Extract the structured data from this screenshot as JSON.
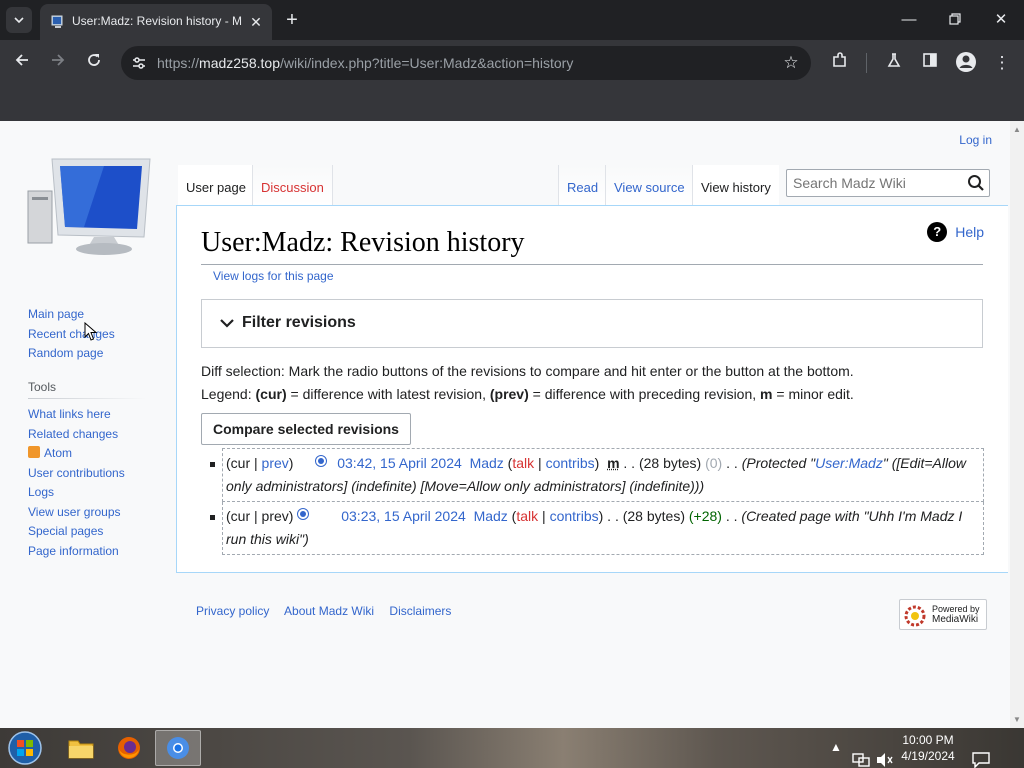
{
  "browser": {
    "tab_title": "User:Madz: Revision history - Madz Wiki",
    "url_scheme": "https://",
    "url_host": "madz258.top",
    "url_path": "/wiki/index.php?title=User:Madz&action=history"
  },
  "wiki": {
    "personal": {
      "login": "Log in"
    },
    "nav": {
      "main_page": "Main page",
      "recent_changes": "Recent changes",
      "random_page": "Random page"
    },
    "tools": {
      "heading": "Tools",
      "items": [
        "What links here",
        "Related changes",
        "Atom",
        "User contributions",
        "Logs",
        "View user groups",
        "Special pages",
        "Page information"
      ]
    },
    "tabs": {
      "user_page": "User page",
      "discussion": "Discussion",
      "read": "Read",
      "view_source": "View source",
      "view_history": "View history"
    },
    "search": {
      "placeholder": "Search Madz Wiki"
    },
    "help": "Help",
    "title": "User:Madz: Revision history",
    "view_logs": "View logs for this page",
    "filter": "Filter revisions",
    "diff_selection": "Diff selection: Mark the radio buttons of the revisions to compare and hit enter or the button at the bottom.",
    "legend": {
      "prefix": "Legend: ",
      "cur": "(cur)",
      "cur_desc": " = difference with latest revision, ",
      "prev": "(prev)",
      "prev_desc": " = difference with preceding revision, ",
      "m": "m",
      "m_desc": " = minor edit."
    },
    "compare_button": "Compare selected revisions",
    "revisions": [
      {
        "cur": "cur",
        "prev": "prev",
        "date": "03:42, 15 April 2024",
        "user": "Madz",
        "talk": "talk",
        "contribs": "contribs",
        "minor": "m",
        "size": "(28 bytes)",
        "diff": "(0)",
        "comment_pre": "(Protected \"",
        "comment_link": "User:Madz",
        "comment_post": "\" ([Edit=Allow only administrators] (indefinite) [Move=Allow only administrators] (indefinite)))"
      },
      {
        "cur": "cur",
        "prev": "prev",
        "date": "03:23, 15 April 2024",
        "user": "Madz",
        "talk": "talk",
        "contribs": "contribs",
        "size": "(28 bytes)",
        "diff": "(+28)",
        "comment": "(Created page with \"Uhh I'm Madz I run this wiki\")"
      }
    ],
    "footer": {
      "privacy": "Privacy policy",
      "about": "About Madz Wiki",
      "disclaimers": "Disclaimers",
      "powered_1": "Powered by",
      "powered_2": "MediaWiki"
    }
  },
  "taskbar": {
    "time": "10:00 PM",
    "date": "4/19/2024"
  }
}
